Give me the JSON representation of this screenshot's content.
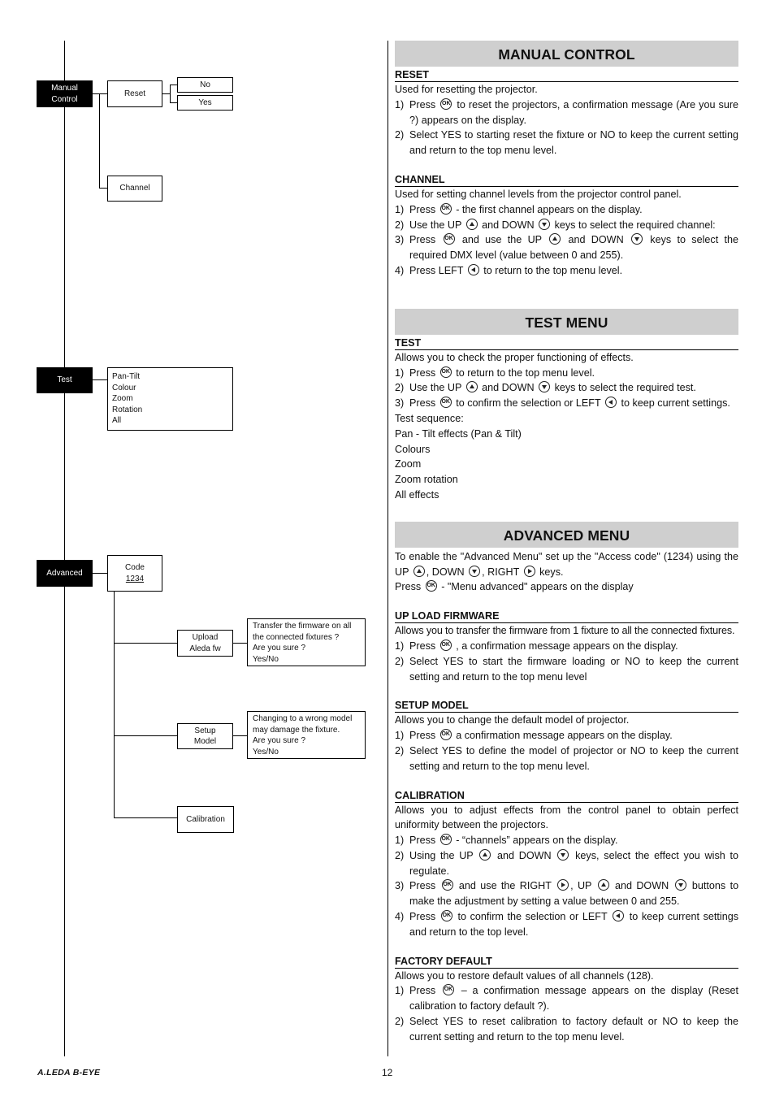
{
  "diagram": {
    "manual_control": {
      "root_label_line1": "Manual",
      "root_label_line2": "Control",
      "reset_label": "Reset",
      "reset_options": [
        "No",
        "Yes"
      ],
      "channel_label": "Channel"
    },
    "test": {
      "root_label": "Test",
      "items": [
        "Pan-Tilt",
        "Colour",
        "Zoom",
        "Rotation",
        "All"
      ]
    },
    "advanced": {
      "root_label": "Advanced",
      "code_label": "Code",
      "code_value": "1234",
      "upload_line1": "Upload",
      "upload_line2": "Aleda fw",
      "upload_msg": [
        "Transfer the firmware on all",
        "the connected fixtures ?",
        "Are you sure ?",
        "Yes/No"
      ],
      "setup_line1": "Setup",
      "setup_line2": "Model",
      "setup_msg": [
        "Changing to a wrong model",
        "may damage the fixture.",
        "Are you sure ?",
        "Yes/No"
      ],
      "calibration_label": "Calibration"
    }
  },
  "text": {
    "manual_control": {
      "title": "MANUAL CONTROL",
      "reset": {
        "heading": "RESET",
        "intro": "Used for resetting the projector.",
        "s1_num": "1)",
        "s1_a": "Press",
        "s1_b": "to reset the projectors, a confirmation message (Are you sure ?) appears on the display.",
        "s2_num": "2)",
        "s2": "Select YES to starting reset the fixture or NO to keep the current setting and return to the top menu level."
      },
      "channel": {
        "heading": "CHANNEL",
        "intro": "Used for setting channel levels from the projector control panel.",
        "s1_num": "1)",
        "s1_a": "Press",
        "s1_b": "- the first channel appears on the display.",
        "s2_num": "2)",
        "s2_a": "Use the UP",
        "s2_b": "and DOWN",
        "s2_c": "keys to select the required channel:",
        "s3_num": "3)",
        "s3_a": "Press",
        "s3_b": "and use the UP",
        "s3_c": "and DOWN",
        "s3_d": "keys to select the required DMX level (value between 0 and 255).",
        "s4_num": "4)",
        "s4_a": "Press LEFT",
        "s4_b": "to return to the top menu level."
      }
    },
    "test_menu": {
      "title": "TEST MENU",
      "heading": "TEST",
      "intro": "Allows you to check the proper functioning of effects.",
      "s1_num": "1)",
      "s1_a": "Press",
      "s1_b": "to return to the top menu level.",
      "s2_num": "2)",
      "s2_a": "Use the UP",
      "s2_b": "and DOWN",
      "s2_c": "keys to select the required test.",
      "s3_num": "3)",
      "s3_a": "Press",
      "s3_b": "to confirm the selection or LEFT",
      "s3_c": "to keep current settings.",
      "sequence_label": "Test sequence:",
      "sequence": [
        "Pan - Tilt effects (Pan & Tilt)",
        "Colours",
        "Zoom",
        "Zoom rotation",
        "All effects"
      ]
    },
    "advanced_menu": {
      "title": "ADVANCED MENU",
      "intro_a": "To enable the \"Advanced Menu\" set up the \"Access code\" (1234) using the UP",
      "intro_b": ", DOWN",
      "intro_c": ", RIGHT",
      "intro_d": "keys.",
      "press_a": "Press",
      "press_b": "- \"Menu advanced\" appears on the display",
      "upload": {
        "heading": "UP LOAD FIRMWARE",
        "intro": "Allows you to transfer the firmware from 1 fixture to all the connected fixtures.",
        "s1_num": "1)",
        "s1_a": "Press",
        "s1_b": ", a confirmation message appears on the display.",
        "s2_num": "2)",
        "s2": "Select YES to start the firmware loading or NO to keep the current setting and return to the top menu level"
      },
      "setup": {
        "heading": "SETUP MODEL",
        "intro": "Allows you to change the default model of projector.",
        "s1_num": "1)",
        "s1_a": "Press",
        "s1_b": "a confirmation message appears on the display.",
        "s2_num": "2)",
        "s2": "Select YES to define the model of projector or NO to keep the current setting and return to the top menu level."
      },
      "calibration": {
        "heading": "CALIBRATION",
        "intro": "Allows you to adjust effects from the control panel to obtain perfect uniformity between the projectors.",
        "s1_num": "1)",
        "s1_a": "Press",
        "s1_b": "- “channels” appears on the display.",
        "s2_num": "2)",
        "s2_a": "Using the UP",
        "s2_b": "and DOWN",
        "s2_c": "keys, select the effect you wish to regulate.",
        "s3_num": "3)",
        "s3_a": "Press",
        "s3_b": "and use the RIGHT",
        "s3_c": ", UP",
        "s3_d": "and DOWN",
        "s3_e": "buttons to make the adjustment by setting a value between 0 and 255.",
        "s4_num": "4)",
        "s4_a": "Press",
        "s4_b": "to confirm the selection or LEFT",
        "s4_c": "to keep current settings and return to the top level."
      },
      "factory": {
        "heading": "FACTORY DEFAULT",
        "intro": "Allows you to restore default values of all channels (128).",
        "s1_num": "1)",
        "s1_a": "Press",
        "s1_b": "– a confirmation message appears on the display (Reset calibration to factory default ?).",
        "s2_num": "2)",
        "s2": "Select YES to reset calibration to factory default or NO to keep the current setting and return to the top menu level."
      }
    }
  },
  "footer": {
    "brand": "A.LEDA B-EYE",
    "page_number": "12"
  }
}
